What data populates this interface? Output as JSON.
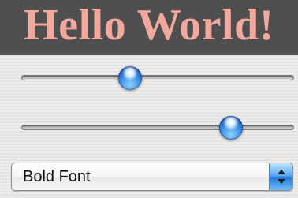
{
  "banner": {
    "text": "Hello World!",
    "text_color": "#f2a89c",
    "background_color": "#4f4f4f"
  },
  "sliders": [
    {
      "name": "slider-1",
      "value_fraction": 0.4
    },
    {
      "name": "slider-2",
      "value_fraction": 0.77
    }
  ],
  "font_popup": {
    "selected_label": "Bold Font",
    "icon": "updown-arrows-icon"
  },
  "colors": {
    "accent": "#3b8fe6"
  }
}
